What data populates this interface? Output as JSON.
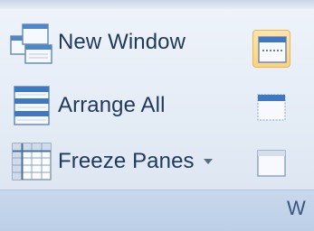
{
  "ribbon_group": {
    "commands": [
      {
        "label": "New Window",
        "icon": "new-window-icon"
      },
      {
        "label": "Arrange All",
        "icon": "arrange-all-icon"
      },
      {
        "label": "Freeze Panes",
        "icon": "freeze-panes-icon",
        "has_dropdown": true
      }
    ],
    "side_buttons": [
      {
        "icon": "split-icon",
        "state": "pressed"
      },
      {
        "icon": "hide-icon",
        "state": "normal"
      },
      {
        "icon": "unhide-icon",
        "state": "normal"
      }
    ],
    "group_label": "W"
  },
  "colors": {
    "label_text": "#1e395b",
    "pressed_bg": "#ffd27a",
    "icon_blue": "#3e78c4"
  }
}
